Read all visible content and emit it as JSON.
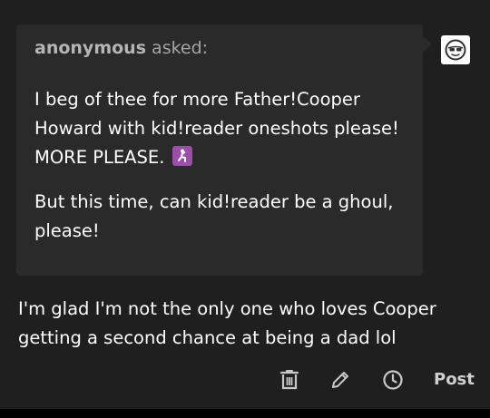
{
  "ask": {
    "asker_name": "anonymous",
    "asked_suffix": "asked:",
    "paragraph1_text": "I beg of thee for more Father!Cooper Howard with kid!reader oneshots please! MORE PLEASE.",
    "paragraph1_emoji": "person-kneeling-emoji",
    "paragraph2_text": "But this time, can kid!reader be a ghoul, please!"
  },
  "answer": {
    "text": "I'm glad I'm not the only one who loves Cooper getting a second chance at being a dad lol"
  },
  "footer": {
    "icons": [
      "trash-icon",
      "pencil-icon",
      "clock-icon"
    ],
    "post_label": "Post"
  },
  "colors": {
    "background": "#1f1f1f",
    "ask_bubble": "#2a2a2a",
    "text": "#ffffff",
    "muted_text": "#a5a5a5",
    "emoji_badge": "#9b4fa8"
  }
}
